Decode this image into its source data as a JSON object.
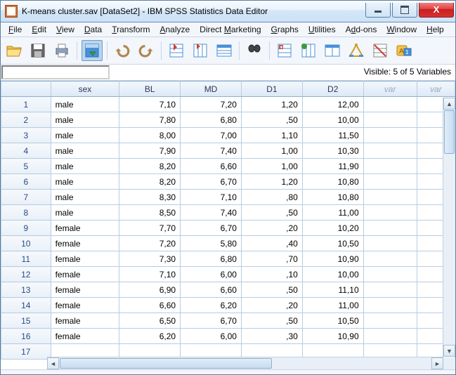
{
  "window": {
    "title": "K-means cluster.sav [DataSet2] - IBM SPSS Statistics Data Editor"
  },
  "menu": {
    "items": [
      "File",
      "Edit",
      "View",
      "Data",
      "Transform",
      "Analyze",
      "Direct Marketing",
      "Graphs",
      "Utilities",
      "Add-ons",
      "Window",
      "Help"
    ],
    "hot": [
      0,
      0,
      0,
      0,
      0,
      0,
      7,
      0,
      0,
      1,
      0,
      0
    ]
  },
  "toolbar": {
    "icons": [
      "open",
      "save",
      "print",
      "sep",
      "recent",
      "sep",
      "undo",
      "redo",
      "sep",
      "goto-case",
      "goto-var",
      "variables",
      "sep",
      "find",
      "sep",
      "insert-case",
      "insert-var",
      "split-file",
      "weight",
      "select",
      "value-labels"
    ]
  },
  "editbar": {
    "cellref": "",
    "visible": "Visible: 5 of 5 Variables"
  },
  "columns": [
    "sex",
    "BL",
    "MD",
    "D1",
    "D2",
    "var",
    "var"
  ],
  "rows": [
    {
      "n": 1,
      "sex": "male",
      "BL": "7,10",
      "MD": "7,20",
      "D1": "1,20",
      "D2": "12,00"
    },
    {
      "n": 2,
      "sex": "male",
      "BL": "7,80",
      "MD": "6,80",
      "D1": ",50",
      "D2": "10,00"
    },
    {
      "n": 3,
      "sex": "male",
      "BL": "8,00",
      "MD": "7,00",
      "D1": "1,10",
      "D2": "11,50"
    },
    {
      "n": 4,
      "sex": "male",
      "BL": "7,90",
      "MD": "7,40",
      "D1": "1,00",
      "D2": "10,30"
    },
    {
      "n": 5,
      "sex": "male",
      "BL": "8,20",
      "MD": "6,60",
      "D1": "1,00",
      "D2": "11,90"
    },
    {
      "n": 6,
      "sex": "male",
      "BL": "8,20",
      "MD": "6,70",
      "D1": "1,20",
      "D2": "10,80"
    },
    {
      "n": 7,
      "sex": "male",
      "BL": "8,30",
      "MD": "7,10",
      "D1": ",80",
      "D2": "10,80"
    },
    {
      "n": 8,
      "sex": "male",
      "BL": "8,50",
      "MD": "7,40",
      "D1": ",50",
      "D2": "11,00"
    },
    {
      "n": 9,
      "sex": "female",
      "BL": "7,70",
      "MD": "6,70",
      "D1": ",20",
      "D2": "10,20"
    },
    {
      "n": 10,
      "sex": "female",
      "BL": "7,20",
      "MD": "5,80",
      "D1": ",40",
      "D2": "10,50"
    },
    {
      "n": 11,
      "sex": "female",
      "BL": "7,30",
      "MD": "6,80",
      "D1": ",70",
      "D2": "10,90"
    },
    {
      "n": 12,
      "sex": "female",
      "BL": "7,10",
      "MD": "6,00",
      "D1": ",10",
      "D2": "10,00"
    },
    {
      "n": 13,
      "sex": "female",
      "BL": "6,90",
      "MD": "6,60",
      "D1": ",50",
      "D2": "11,10"
    },
    {
      "n": 14,
      "sex": "female",
      "BL": "6,60",
      "MD": "6,20",
      "D1": ",20",
      "D2": "11,00"
    },
    {
      "n": 15,
      "sex": "female",
      "BL": "6,50",
      "MD": "6,70",
      "D1": ",50",
      "D2": "10,50"
    },
    {
      "n": 16,
      "sex": "female",
      "BL": "6,20",
      "MD": "6,00",
      "D1": ",30",
      "D2": "10,90"
    },
    {
      "n": 17,
      "sex": "",
      "BL": "",
      "MD": "",
      "D1": "",
      "D2": ""
    }
  ]
}
